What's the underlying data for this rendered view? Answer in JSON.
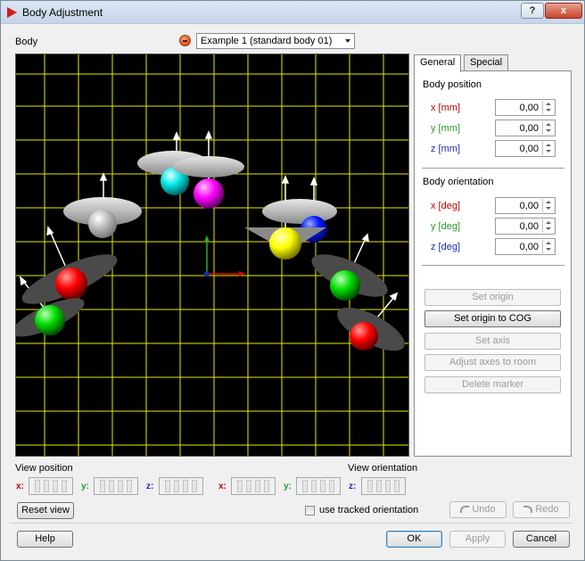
{
  "window": {
    "title": "Body Adjustment",
    "help_btn": "?",
    "close_btn": "x"
  },
  "body": {
    "label": "Body",
    "selected": "Example 1 (standard body 01)"
  },
  "tabs": [
    {
      "label": "General",
      "active": true
    },
    {
      "label": "Special",
      "active": false
    }
  ],
  "position": {
    "title": "Body position",
    "rows": [
      {
        "label": "x [mm]",
        "value": "0,00",
        "color": "#c00000"
      },
      {
        "label": "y [mm]",
        "value": "0,00",
        "color": "#2a9a2a"
      },
      {
        "label": "z [mm]",
        "value": "0,00",
        "color": "#1a2ab8"
      }
    ]
  },
  "orientation": {
    "title": "Body orientation",
    "rows": [
      {
        "label": "x [deg]",
        "value": "0,00",
        "color": "#c00000"
      },
      {
        "label": "y [deg]",
        "value": "0,00",
        "color": "#2a9a2a"
      },
      {
        "label": "z [deg]",
        "value": "0,00",
        "color": "#1a2ab8"
      }
    ]
  },
  "actions": {
    "set_origin": "Set origin",
    "set_origin_cog": "Set origin to COG",
    "set_axis": "Set axis",
    "adjust_axes": "Adjust axes to room",
    "delete_marker": "Delete marker"
  },
  "view": {
    "position_label": "View position",
    "orientation_label": "View orientation",
    "axes": [
      "x:",
      "y:",
      "z:"
    ],
    "reset": "Reset view",
    "tracked": "use tracked orientation",
    "undo": "Undo",
    "redo": "Redo"
  },
  "footer": {
    "help": "Help",
    "ok": "OK",
    "apply": "Apply",
    "cancel": "Cancel"
  },
  "colors": {
    "axis_x": "#e00000",
    "axis_y": "#22b022",
    "axis_z": "#1a2ab8",
    "grid": "#e8e800"
  }
}
